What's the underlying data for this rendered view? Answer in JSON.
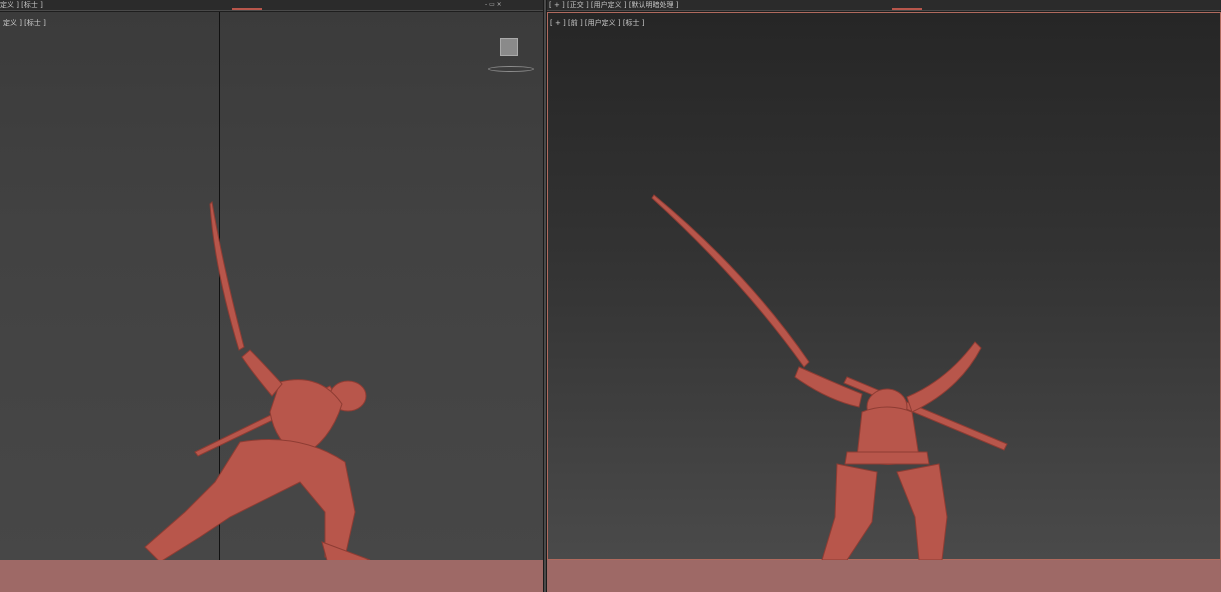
{
  "left_viewport": {
    "strip_text": "定义 ] [标士 ]",
    "label": "定义 ] [标士 ]",
    "strip_controls": "-  ▭  ×"
  },
  "right_viewport": {
    "strip_text": "[ + ] [正交 ] [用户定义 ] [默认明暗处理 ]",
    "label": "[ + ] [前 ] [用户定义 ] [标士 ]"
  },
  "colors": {
    "model": "#b8564b",
    "ground": "#9e6966",
    "active_border": "#b06a5e"
  },
  "icons": [
    "viewcube-icon",
    "viewcube-ring-icon"
  ]
}
